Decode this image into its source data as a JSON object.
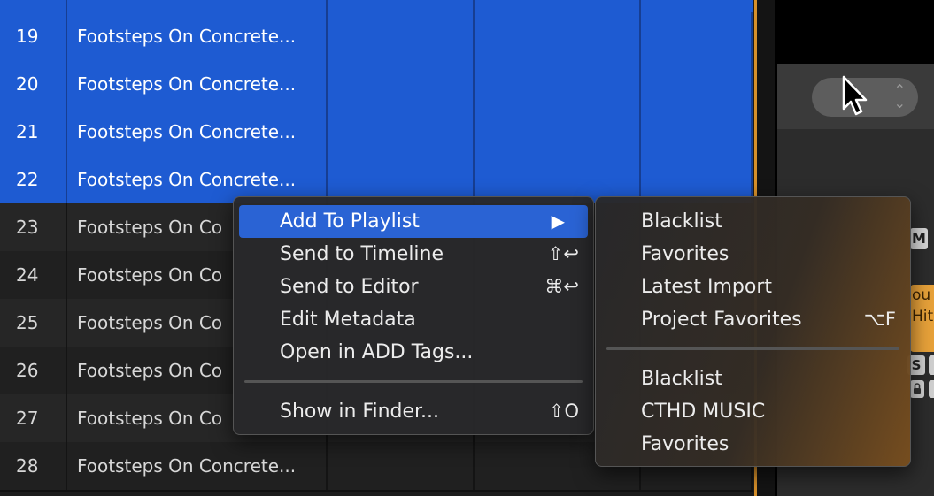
{
  "table": {
    "top_partial_row": true,
    "rows": [
      {
        "num": "19",
        "name": "Footsteps On Concrete...",
        "selected": true
      },
      {
        "num": "20",
        "name": "Footsteps On Concrete...",
        "selected": true
      },
      {
        "num": "21",
        "name": "Footsteps On Concrete...",
        "selected": true
      },
      {
        "num": "22",
        "name": "Footsteps On Concrete...",
        "selected": true
      },
      {
        "num": "23",
        "name": "Footsteps On Co",
        "selected": false
      },
      {
        "num": "24",
        "name": "Footsteps On Co",
        "selected": false
      },
      {
        "num": "25",
        "name": "Footsteps On Co",
        "selected": false
      },
      {
        "num": "26",
        "name": "Footsteps On Co",
        "selected": false
      },
      {
        "num": "27",
        "name": "Footsteps On Co",
        "selected": false
      },
      {
        "num": "28",
        "name": "Footsteps On Concrete...",
        "selected": false
      }
    ]
  },
  "context_menu": {
    "items": [
      {
        "label": "Add To Playlist",
        "shortcut": "",
        "submenu_arrow": "▶",
        "highlighted": true
      },
      {
        "label": "Send to Timeline",
        "shortcut": "⇧↩",
        "highlighted": false
      },
      {
        "label": "Send to Editor",
        "shortcut": "⌘↩",
        "highlighted": false
      },
      {
        "label": "Edit Metadata",
        "shortcut": "",
        "highlighted": false
      },
      {
        "label": "Open in ADD Tags...",
        "shortcut": "",
        "highlighted": false
      },
      {
        "label": "Show in Finder...",
        "shortcut": "⇧O",
        "highlighted": false
      }
    ]
  },
  "submenu": {
    "group1": [
      {
        "label": "Blacklist",
        "shortcut": ""
      },
      {
        "label": "Favorites",
        "shortcut": ""
      },
      {
        "label": "Latest Import",
        "shortcut": ""
      },
      {
        "label": "Project Favorites",
        "shortcut": "⌥F"
      }
    ],
    "group2": [
      {
        "label": "Blacklist",
        "shortcut": ""
      },
      {
        "label": "CTHD MUSIC",
        "shortcut": ""
      },
      {
        "label": "Favorites",
        "shortcut": ""
      }
    ]
  },
  "right_panel": {
    "m_badge": "M",
    "orange_card_lines": [
      "ou",
      "Hit"
    ],
    "s_badge": "S"
  },
  "colors": {
    "selection_blue": "#1e5bd2",
    "menu_highlight": "#2a63d4",
    "playhead_orange": "#d7902a",
    "card_orange": "#e8a23a"
  },
  "icons": {
    "submenu_arrow": "triangle-right-icon",
    "popup_arrows": "up-down-chevron-icon",
    "cursor": "mouse-pointer-icon",
    "lock": "lock-icon"
  }
}
